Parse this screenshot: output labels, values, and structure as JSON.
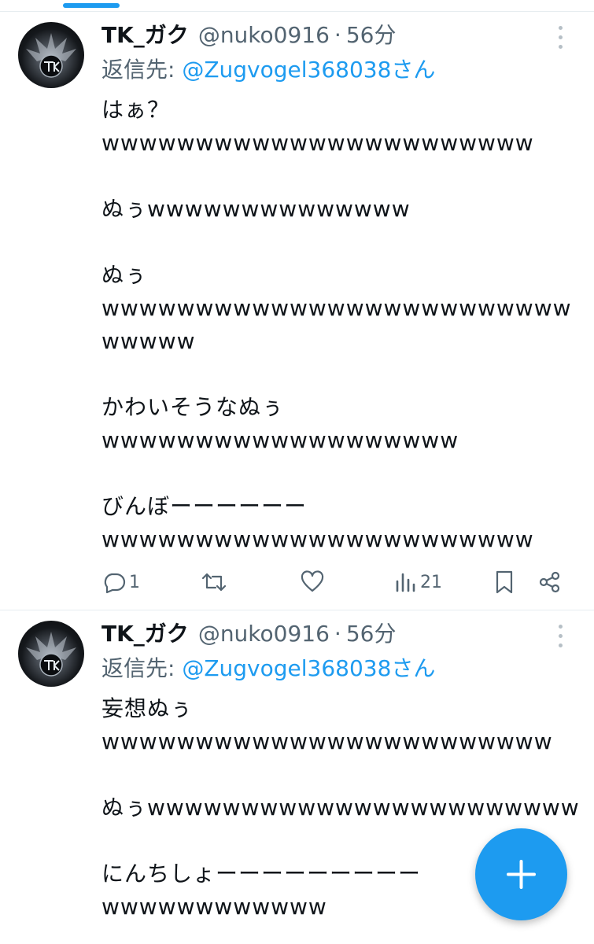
{
  "tweets": [
    {
      "author": {
        "name": "TK_ガク",
        "handle": "@nuko0916"
      },
      "separator": "·",
      "time": "56分",
      "reply_prefix": "返信先: ",
      "reply_to": "@Zugvogel368038さん",
      "text": "はぁ？\nwwwwwwwwwwwwwwwwwwwwwww\n\nぬぅwwwwwwwwwwwwww\n\nぬぅ\nwwwwwwwwwwwwwwwwwwwwwwwwwwwwww\n\nかわいそうなぬぅ\nwwwwwwwwwwwwwwwwwww\n\nびんぼーーーーーー\nwwwwwwwwwwwwwwwwwwwwwww",
      "stats": {
        "replies": "1",
        "views": "21"
      }
    },
    {
      "author": {
        "name": "TK_ガク",
        "handle": "@nuko0916"
      },
      "separator": "·",
      "time": "56分",
      "reply_prefix": "返信先: ",
      "reply_to": "@Zugvogel368038さん",
      "text": "妄想ぬぅ\nwwwwwwwwwwwwwwwwwwwwwwww\n\nぬぅwwwwwwwwwwwwwwwwwwwwwww\n\nにんちしょーーーーーーーーー\nwwwwwwwwwwww"
    }
  ],
  "icons": {
    "reply": "speech-bubble-icon",
    "retweet": "retweet-arrows-icon",
    "like": "heart-icon",
    "views": "bar-chart-icon",
    "bookmark": "bookmark-icon",
    "share": "share-icon",
    "compose": "plus-icon",
    "more": "vertical-dots-icon"
  },
  "colors": {
    "accent": "#1d9bf0",
    "text": "#0f1419",
    "secondary": "#536471",
    "divider": "#e6ecf0"
  }
}
